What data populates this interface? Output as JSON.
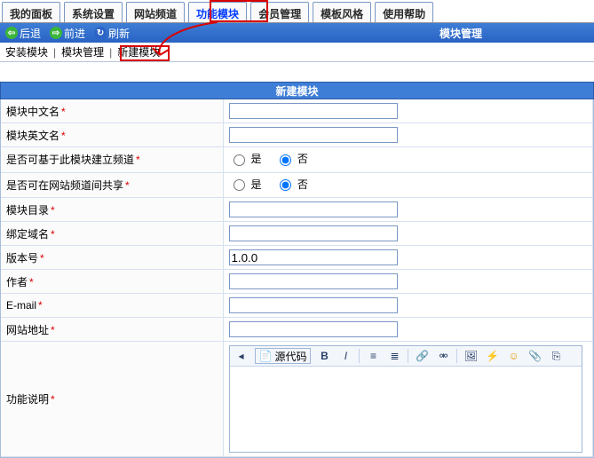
{
  "tabs": {
    "items": [
      "我的面板",
      "系统设置",
      "网站频道",
      "功能模块",
      "会员管理",
      "模板风格",
      "使用帮助"
    ],
    "active_index": 3
  },
  "navbar": {
    "back": "后退",
    "forward": "前进",
    "refresh": "刷新",
    "title": "模块管理"
  },
  "subtabs": {
    "items": [
      "安装模块",
      "模块管理",
      "新建模块"
    ]
  },
  "form_title": "新建模块",
  "form": {
    "r0": {
      "label": "模块中文名",
      "required": true,
      "value": ""
    },
    "r1": {
      "label": "模块英文名",
      "required": true,
      "value": ""
    },
    "r2": {
      "label": "是否可基于此模块建立频道",
      "required": true,
      "type": "radio",
      "selected": "否"
    },
    "r3": {
      "label": "是否可在网站频道间共享",
      "required": true,
      "type": "radio",
      "selected": "否"
    },
    "r4": {
      "label": "模块目录",
      "required": true,
      "value": ""
    },
    "r5": {
      "label": "绑定域名",
      "required": true,
      "value": ""
    },
    "r6": {
      "label": "版本号",
      "required": true,
      "value": "1.0.0"
    },
    "r7": {
      "label": "作者",
      "required": true,
      "value": ""
    },
    "r8": {
      "label": "E-mail",
      "required": true,
      "value": ""
    },
    "r9": {
      "label": "网站地址",
      "required": true,
      "value": ""
    },
    "r10": {
      "label": "功能说明",
      "required": true,
      "type": "editor"
    }
  },
  "radio_options": {
    "yes": "是",
    "no": "否"
  },
  "editor": {
    "source_label": "源代码"
  }
}
